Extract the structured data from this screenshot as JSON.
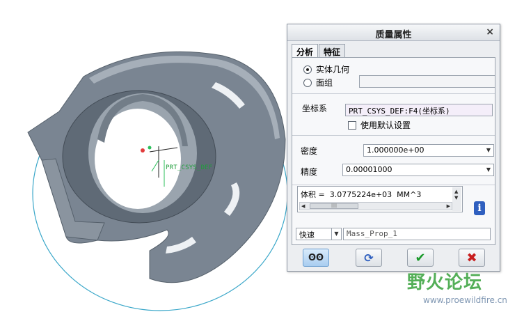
{
  "viewport": {
    "csys_label": "PRT_CSYS_DEF"
  },
  "dialog": {
    "title": "质量属性",
    "close_glyph": "×",
    "tabs": [
      {
        "label": "分析"
      },
      {
        "label": "特征"
      }
    ],
    "geometry_options": [
      {
        "label": "实体几何",
        "selected": true
      },
      {
        "label": "面组",
        "selected": false
      }
    ],
    "csys_label": "坐标系",
    "csys_value": "PRT_CSYS_DEF:F4(坐标系)",
    "use_default_label": "使用默认设置",
    "density_label": "密度",
    "density_value": "1.000000e+00",
    "accuracy_label": "精度",
    "accuracy_value": "0.00001000",
    "result_text": "体积 =  3.0775224e+03  MM^3",
    "mode_value": "快速",
    "name_value": "Mass_Prop_1",
    "icons": [
      "preview-glasses-icon",
      "repeat-arrows-icon",
      "ok-check-icon",
      "cancel-x-icon",
      "info-icon"
    ],
    "colors": {
      "ok": "#1a9a2a",
      "cancel": "#c81e1e",
      "info": "#2f5fbf"
    }
  },
  "watermark": {
    "text": "野火论坛",
    "url": "www.proewildfire.cn"
  }
}
